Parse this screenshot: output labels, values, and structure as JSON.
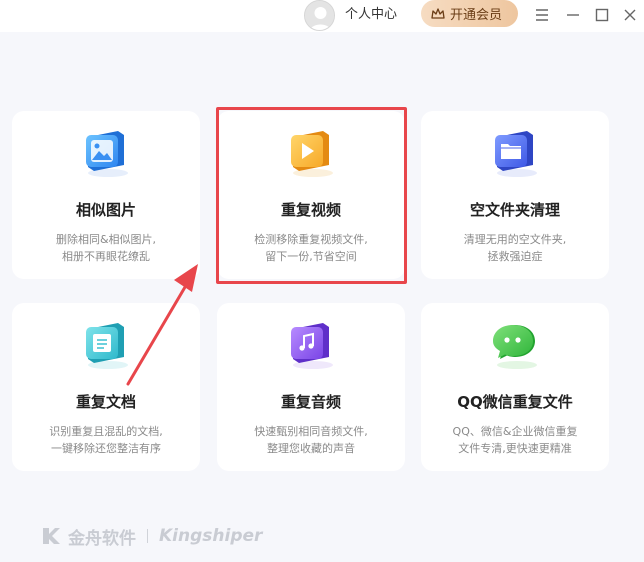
{
  "header": {
    "profile_label": "个人中心",
    "vip_label": "开通会员",
    "accent_vip": "#eec69f"
  },
  "cards": [
    {
      "title": "相似图片",
      "desc1": "删除相同&相似图片,",
      "desc2": "相册不再眼花缭乱",
      "icon": "image-icon"
    },
    {
      "title": "重复视频",
      "desc1": "检测移除重复视频文件,",
      "desc2": "留下一份,节省空间",
      "icon": "video-icon"
    },
    {
      "title": "空文件夹清理",
      "desc1": "清理无用的空文件夹,",
      "desc2": "拯救强迫症",
      "icon": "folder-icon"
    },
    {
      "title": "重复文档",
      "desc1": "识别重复且混乱的文档,",
      "desc2": "一键移除还您整洁有序",
      "icon": "document-icon"
    },
    {
      "title": "重复音频",
      "desc1": "快速甄别相同音频文件,",
      "desc2": "整理您收藏的声音",
      "icon": "music-icon"
    },
    {
      "title": "QQ微信重复文件",
      "desc1": "QQ、微信&企业微信重复",
      "desc2": "文件专清,更快速更精准",
      "icon": "chat-icon"
    }
  ],
  "footer": {
    "brand_cn": "金舟软件",
    "brand_en": "Kingshiper"
  },
  "colors": {
    "highlight": "#e8464b",
    "background": "#f6f7fb"
  }
}
